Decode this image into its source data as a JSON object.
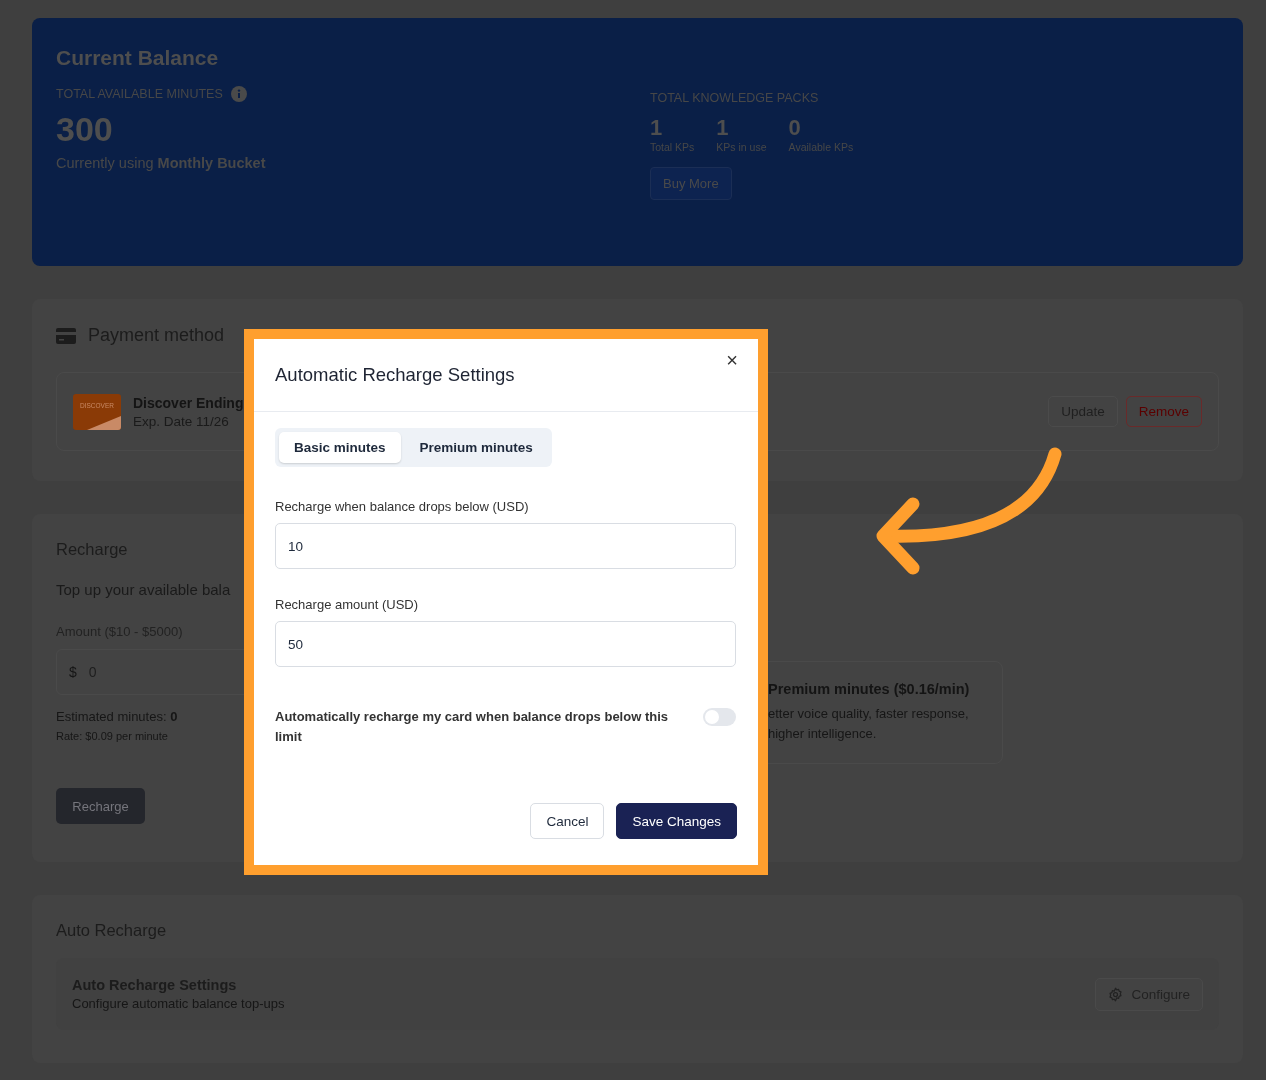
{
  "balance": {
    "title": "Current Balance",
    "minutes_label": "TOTAL AVAILABLE MINUTES",
    "minutes": "300",
    "bucket_note": "Currently using **Monthly Bucket**",
    "packs_label": "TOTAL KNOWLEDGE PACKS",
    "packs": [
      {
        "value": "1",
        "label": "Total KPs"
      },
      {
        "value": "1",
        "label": "KPs in use"
      },
      {
        "value": "0",
        "label": "Available KPs"
      }
    ],
    "buy_button": "Buy More"
  },
  "payment": {
    "title": "Payment method",
    "logo_text": "DISCOVER",
    "card_name": "Discover Ending",
    "card_expiry": "Exp. Date 11/26",
    "buttons": [
      {
        "label": "Update",
        "kind": "default"
      },
      {
        "label": "Remove",
        "kind": "danger"
      }
    ]
  },
  "recharge": {
    "title": "Recharge",
    "subtitle": "Top up your available bala",
    "amount_label": "Amount ($10 - $5000)",
    "currency": "$",
    "amount_value": "0",
    "estimate": "Estimated minutes: **0**",
    "rate": "Rate: $0.09 per minute",
    "button": "Recharge",
    "premium": {
      "title": "Premium minutes ($0.16/min)",
      "description": "etter voice quality, faster response, higher intelligence."
    }
  },
  "auto_recharge": {
    "title": "Auto Recharge",
    "item_title": "Auto Recharge Settings",
    "item_subtitle": "Configure automatic balance top-ups",
    "button": "Configure"
  },
  "dialog": {
    "title": "Automatic Recharge Settings",
    "close": "×",
    "tabs": [
      {
        "label": "Basic minutes",
        "selected": true
      },
      {
        "label": "Premium minutes",
        "selected": false
      }
    ],
    "fields": [
      {
        "label": "Recharge when balance drops below (USD)",
        "value": "10"
      },
      {
        "label": "Recharge amount (USD)",
        "value": "50"
      }
    ],
    "toggle": {
      "label": "Automatically recharge my card when balance drops below this limit",
      "on": false
    },
    "buttons": [
      {
        "label": "Cancel",
        "kind": "secondary"
      },
      {
        "label": "Save Changes",
        "kind": "primary"
      }
    ]
  }
}
